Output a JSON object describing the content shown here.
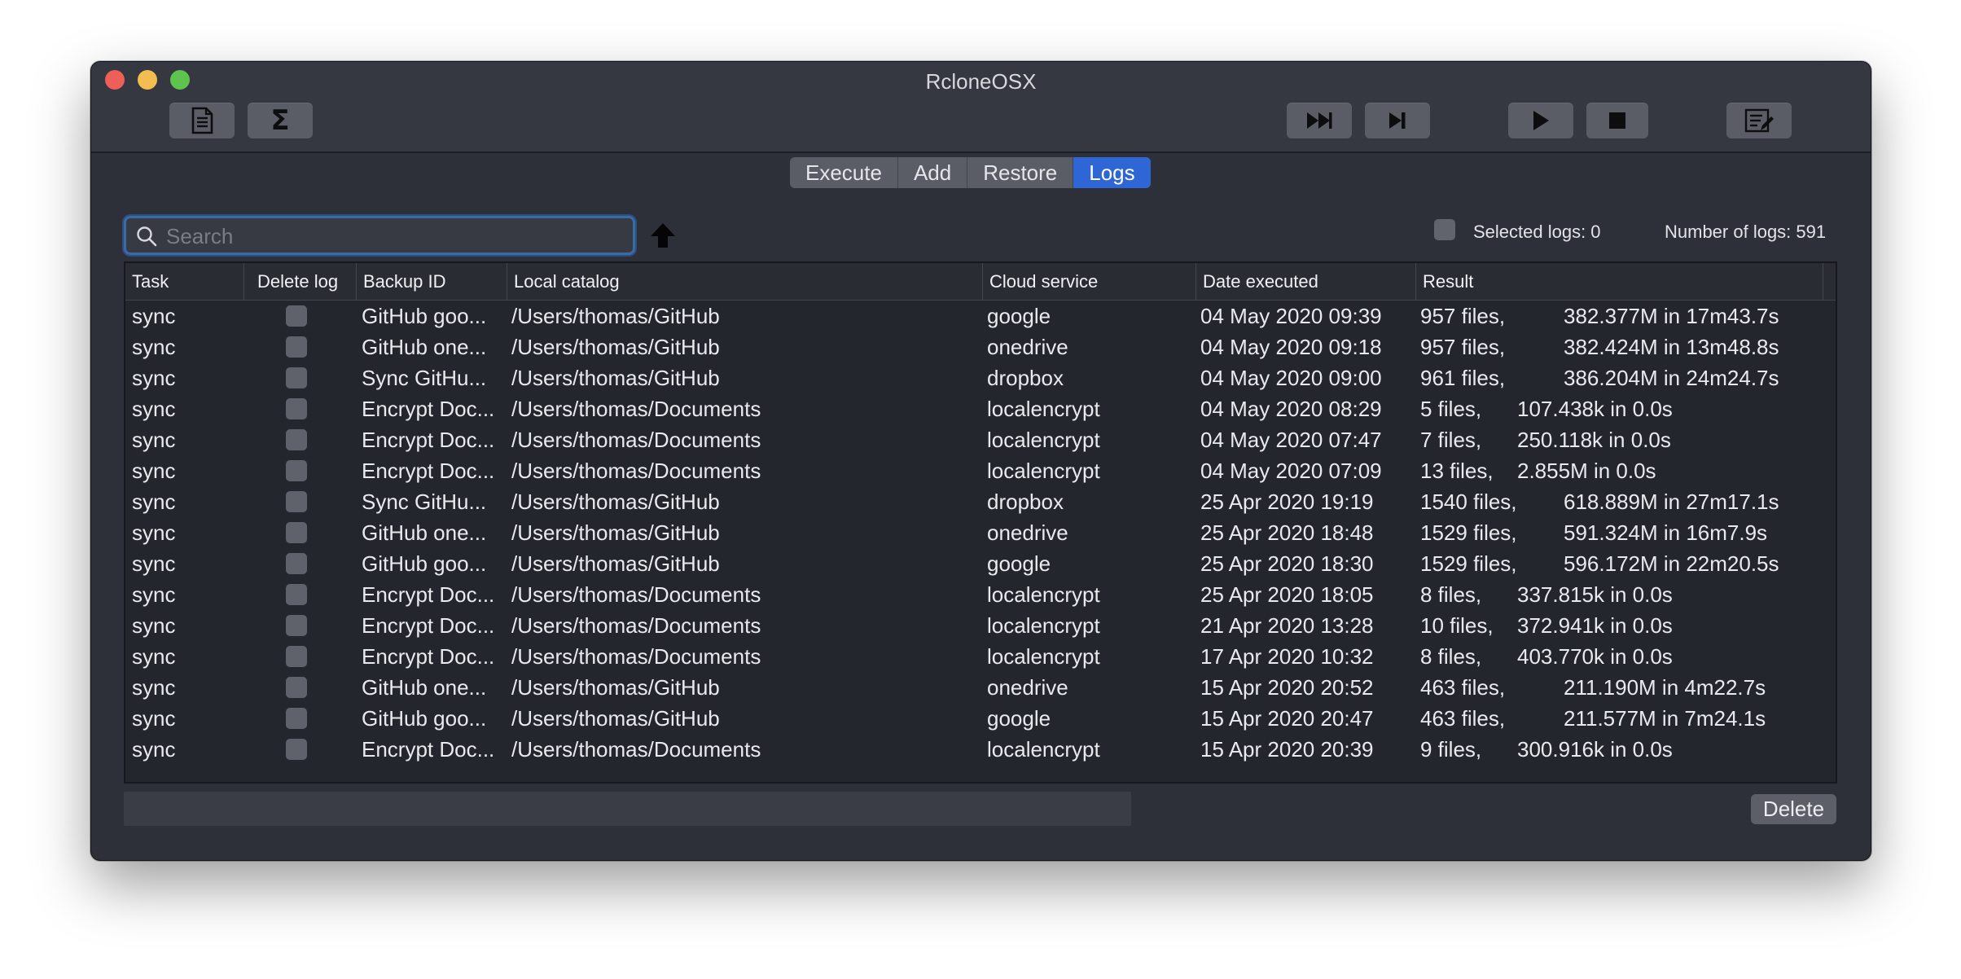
{
  "window": {
    "title": "RcloneOSX"
  },
  "toolbar": {
    "left": [
      {
        "name": "document-icon"
      },
      {
        "name": "sigma-icon",
        "glyph": "Σ"
      }
    ],
    "right": [
      {
        "name": "fast-forward-icon"
      },
      {
        "name": "skip-forward-icon"
      },
      {
        "name": "play-icon"
      },
      {
        "name": "stop-icon"
      },
      {
        "name": "edit-list-icon"
      }
    ]
  },
  "tabs": [
    {
      "label": "Execute",
      "active": false
    },
    {
      "label": "Add",
      "active": false
    },
    {
      "label": "Restore",
      "active": false
    },
    {
      "label": "Logs",
      "active": true
    }
  ],
  "search": {
    "placeholder": "Search",
    "value": ""
  },
  "selected_logs_label": "Selected logs: 0",
  "number_of_logs_label": "Number of logs: 591",
  "table": {
    "columns": [
      "Task",
      "Delete log",
      "Backup ID",
      "Local catalog",
      "Cloud service",
      "Date executed",
      "Result"
    ],
    "rows": [
      {
        "task": "sync",
        "backup_id": "GitHub goo...",
        "local": "/Users/thomas/GitHub",
        "cloud": "google",
        "date": "04 May 2020 09:39",
        "files": "957 files,",
        "result": "382.377M in 17m43.7s"
      },
      {
        "task": "sync",
        "backup_id": "GitHub one...",
        "local": "/Users/thomas/GitHub",
        "cloud": "onedrive",
        "date": "04 May 2020 09:18",
        "files": "957 files,",
        "result": "382.424M in 13m48.8s"
      },
      {
        "task": "sync",
        "backup_id": "Sync GitHu...",
        "local": "/Users/thomas/GitHub",
        "cloud": "dropbox",
        "date": "04 May 2020 09:00",
        "files": "961 files,",
        "result": "386.204M in 24m24.7s"
      },
      {
        "task": "sync",
        "backup_id": "Encrypt Doc...",
        "local": "/Users/thomas/Documents",
        "cloud": "localencrypt",
        "date": "04 May 2020 08:29",
        "files": "5 files,",
        "result": "107.438k in 0.0s"
      },
      {
        "task": "sync",
        "backup_id": "Encrypt Doc...",
        "local": "/Users/thomas/Documents",
        "cloud": "localencrypt",
        "date": "04 May 2020 07:47",
        "files": "7 files,",
        "result": "250.118k in 0.0s"
      },
      {
        "task": "sync",
        "backup_id": "Encrypt Doc...",
        "local": "/Users/thomas/Documents",
        "cloud": "localencrypt",
        "date": "04 May 2020 07:09",
        "files": "13 files,",
        "result": "2.855M in 0.0s"
      },
      {
        "task": "sync",
        "backup_id": "Sync GitHu...",
        "local": "/Users/thomas/GitHub",
        "cloud": "dropbox",
        "date": "25 Apr 2020 19:19",
        "files": "1540 files,",
        "result": "618.889M in 27m17.1s"
      },
      {
        "task": "sync",
        "backup_id": "GitHub one...",
        "local": "/Users/thomas/GitHub",
        "cloud": "onedrive",
        "date": "25 Apr 2020 18:48",
        "files": "1529 files,",
        "result": "591.324M in 16m7.9s"
      },
      {
        "task": "sync",
        "backup_id": "GitHub goo...",
        "local": "/Users/thomas/GitHub",
        "cloud": "google",
        "date": "25 Apr 2020 18:30",
        "files": "1529 files,",
        "result": "596.172M in 22m20.5s"
      },
      {
        "task": "sync",
        "backup_id": "Encrypt Doc...",
        "local": "/Users/thomas/Documents",
        "cloud": "localencrypt",
        "date": "25 Apr 2020 18:05",
        "files": "8 files,",
        "result": "337.815k in 0.0s"
      },
      {
        "task": "sync",
        "backup_id": "Encrypt Doc...",
        "local": "/Users/thomas/Documents",
        "cloud": "localencrypt",
        "date": "21 Apr 2020 13:28",
        "files": "10 files,",
        "result": "372.941k in 0.0s"
      },
      {
        "task": "sync",
        "backup_id": "Encrypt Doc...",
        "local": "/Users/thomas/Documents",
        "cloud": "localencrypt",
        "date": "17 Apr 2020 10:32",
        "files": "8 files,",
        "result": "403.770k in 0.0s"
      },
      {
        "task": "sync",
        "backup_id": "GitHub one...",
        "local": "/Users/thomas/GitHub",
        "cloud": "onedrive",
        "date": "15 Apr 2020 20:52",
        "files": "463 files,",
        "result": "211.190M in 4m22.7s"
      },
      {
        "task": "sync",
        "backup_id": "GitHub goo...",
        "local": "/Users/thomas/GitHub",
        "cloud": "google",
        "date": "15 Apr 2020 20:47",
        "files": "463 files,",
        "result": "211.577M in 7m24.1s"
      },
      {
        "task": "sync",
        "backup_id": "Encrypt Doc...",
        "local": "/Users/thomas/Documents",
        "cloud": "localencrypt",
        "date": "15 Apr 2020 20:39",
        "files": "9 files,",
        "result": "300.916k in 0.0s"
      }
    ]
  },
  "buttons": {
    "delete": "Delete"
  },
  "colors": {
    "accent": "#2f66d6",
    "window_bg": "#2e3039",
    "table_bg": "#24262e"
  }
}
